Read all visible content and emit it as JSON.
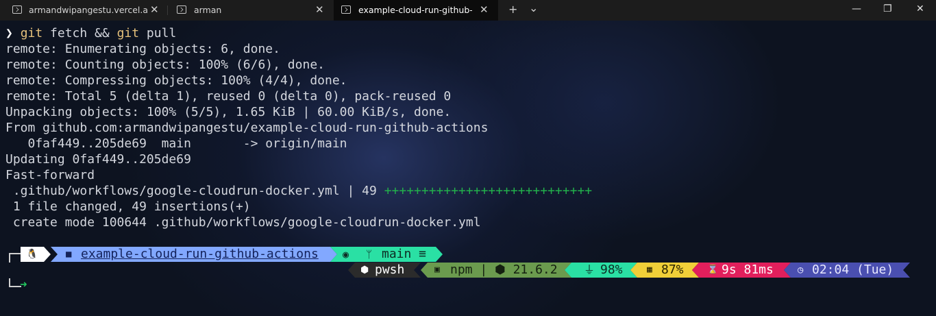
{
  "tabs": [
    {
      "title": "armandwipangestu.vercel.app",
      "icon": "terminal-icon"
    },
    {
      "title": "arman",
      "icon": "terminal-icon"
    },
    {
      "title": "example-cloud-run-github-ac",
      "icon": "terminal-icon"
    }
  ],
  "tabbar": {
    "new_tab": "+",
    "dropdown": "⌄",
    "close": "✕"
  },
  "window": {
    "minimize": "—",
    "maximize": "❐",
    "close": "✕"
  },
  "command": {
    "prompt": "❯",
    "git1": "git",
    "text1": " fetch && ",
    "git2": "git",
    "text2": " pull"
  },
  "output": [
    "remote: Enumerating objects: 6, done.",
    "remote: Counting objects: 100% (6/6), done.",
    "remote: Compressing objects: 100% (4/4), done.",
    "remote: Total 5 (delta 1), reused 0 (delta 0), pack-reused 0",
    "Unpacking objects: 100% (5/5), 1.65 KiB | 60.00 KiB/s, done.",
    "From github.com:armandwipangestu/example-cloud-run-github-actions",
    "   0faf449..205de69  main       -> origin/main",
    "Updating 0faf449..205de69",
    "Fast-forward"
  ],
  "diffstat": {
    "file": " .github/workflows/google-cloudrun-docker.yml | 49 ",
    "plus": "++++++++++++++++++++++++++++"
  },
  "summary": [
    " 1 file changed, 49 insertions(+)",
    " create mode 100644 .github/workflows/google-cloudrun-docker.yml"
  ],
  "powerline_top": {
    "os_icon": "🐧",
    "folder": "example-cloud-run-github-actions",
    "git": "main ≡"
  },
  "powerline_right": {
    "shell": "pwsh",
    "node": "npm | ⬢ 21.6.2",
    "battery": "98%",
    "memory": "87%",
    "exec_time": "9s 81ms",
    "time": "02:04 (Tue)"
  },
  "colors": {
    "folder": "#82a8ff",
    "git": "#2ae0a4",
    "shell": "#2b2b2b",
    "node": "#6b9b4e",
    "battery": "#2ae0a4",
    "memory": "#f0cf38",
    "exec_time": "#e21f5c",
    "time": "#4a4fb0"
  }
}
